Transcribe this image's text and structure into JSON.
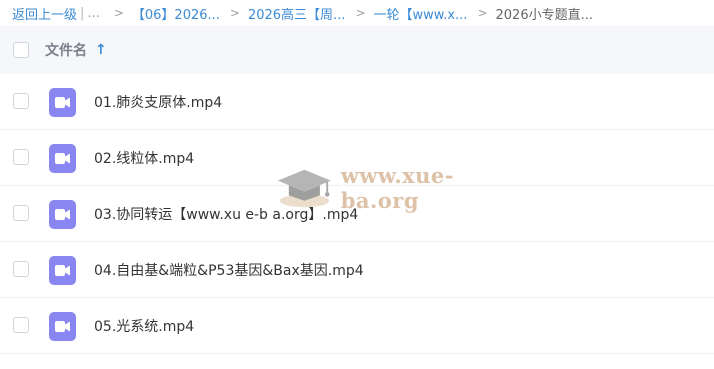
{
  "breadcrumb": {
    "back_label": "返回上一级",
    "separator": "|",
    "ellipsis": "...",
    "items": [
      {
        "label": "【06】2026..."
      },
      {
        "label": "2026高三【周..."
      },
      {
        "label": "一轮【www.x..."
      },
      {
        "label": "2026小专题直..."
      }
    ],
    "arrow": ">"
  },
  "list_header": {
    "column_title": "文件名",
    "sort_indicator": "↑"
  },
  "files": [
    {
      "name": "01.肺炎支原体.mp4",
      "icon": "video-file-icon"
    },
    {
      "name": "02.线粒体.mp4",
      "icon": "video-file-icon"
    },
    {
      "name": "03.协同转运【www.xu e-b a.org】.mp4",
      "icon": "video-file-icon"
    },
    {
      "name": "04.自由基&端粒&P53基因&Bax基因.mp4",
      "icon": "video-file-icon"
    },
    {
      "name": "05.光系统.mp4",
      "icon": "video-file-icon"
    }
  ],
  "watermark": {
    "text": "www.xue-ba.org",
    "icon": "graduation-cap-icon"
  },
  "colors": {
    "accent": "#3b8bd6",
    "file_icon": "#8a86f0",
    "header_bg": "#f5f7fa"
  }
}
